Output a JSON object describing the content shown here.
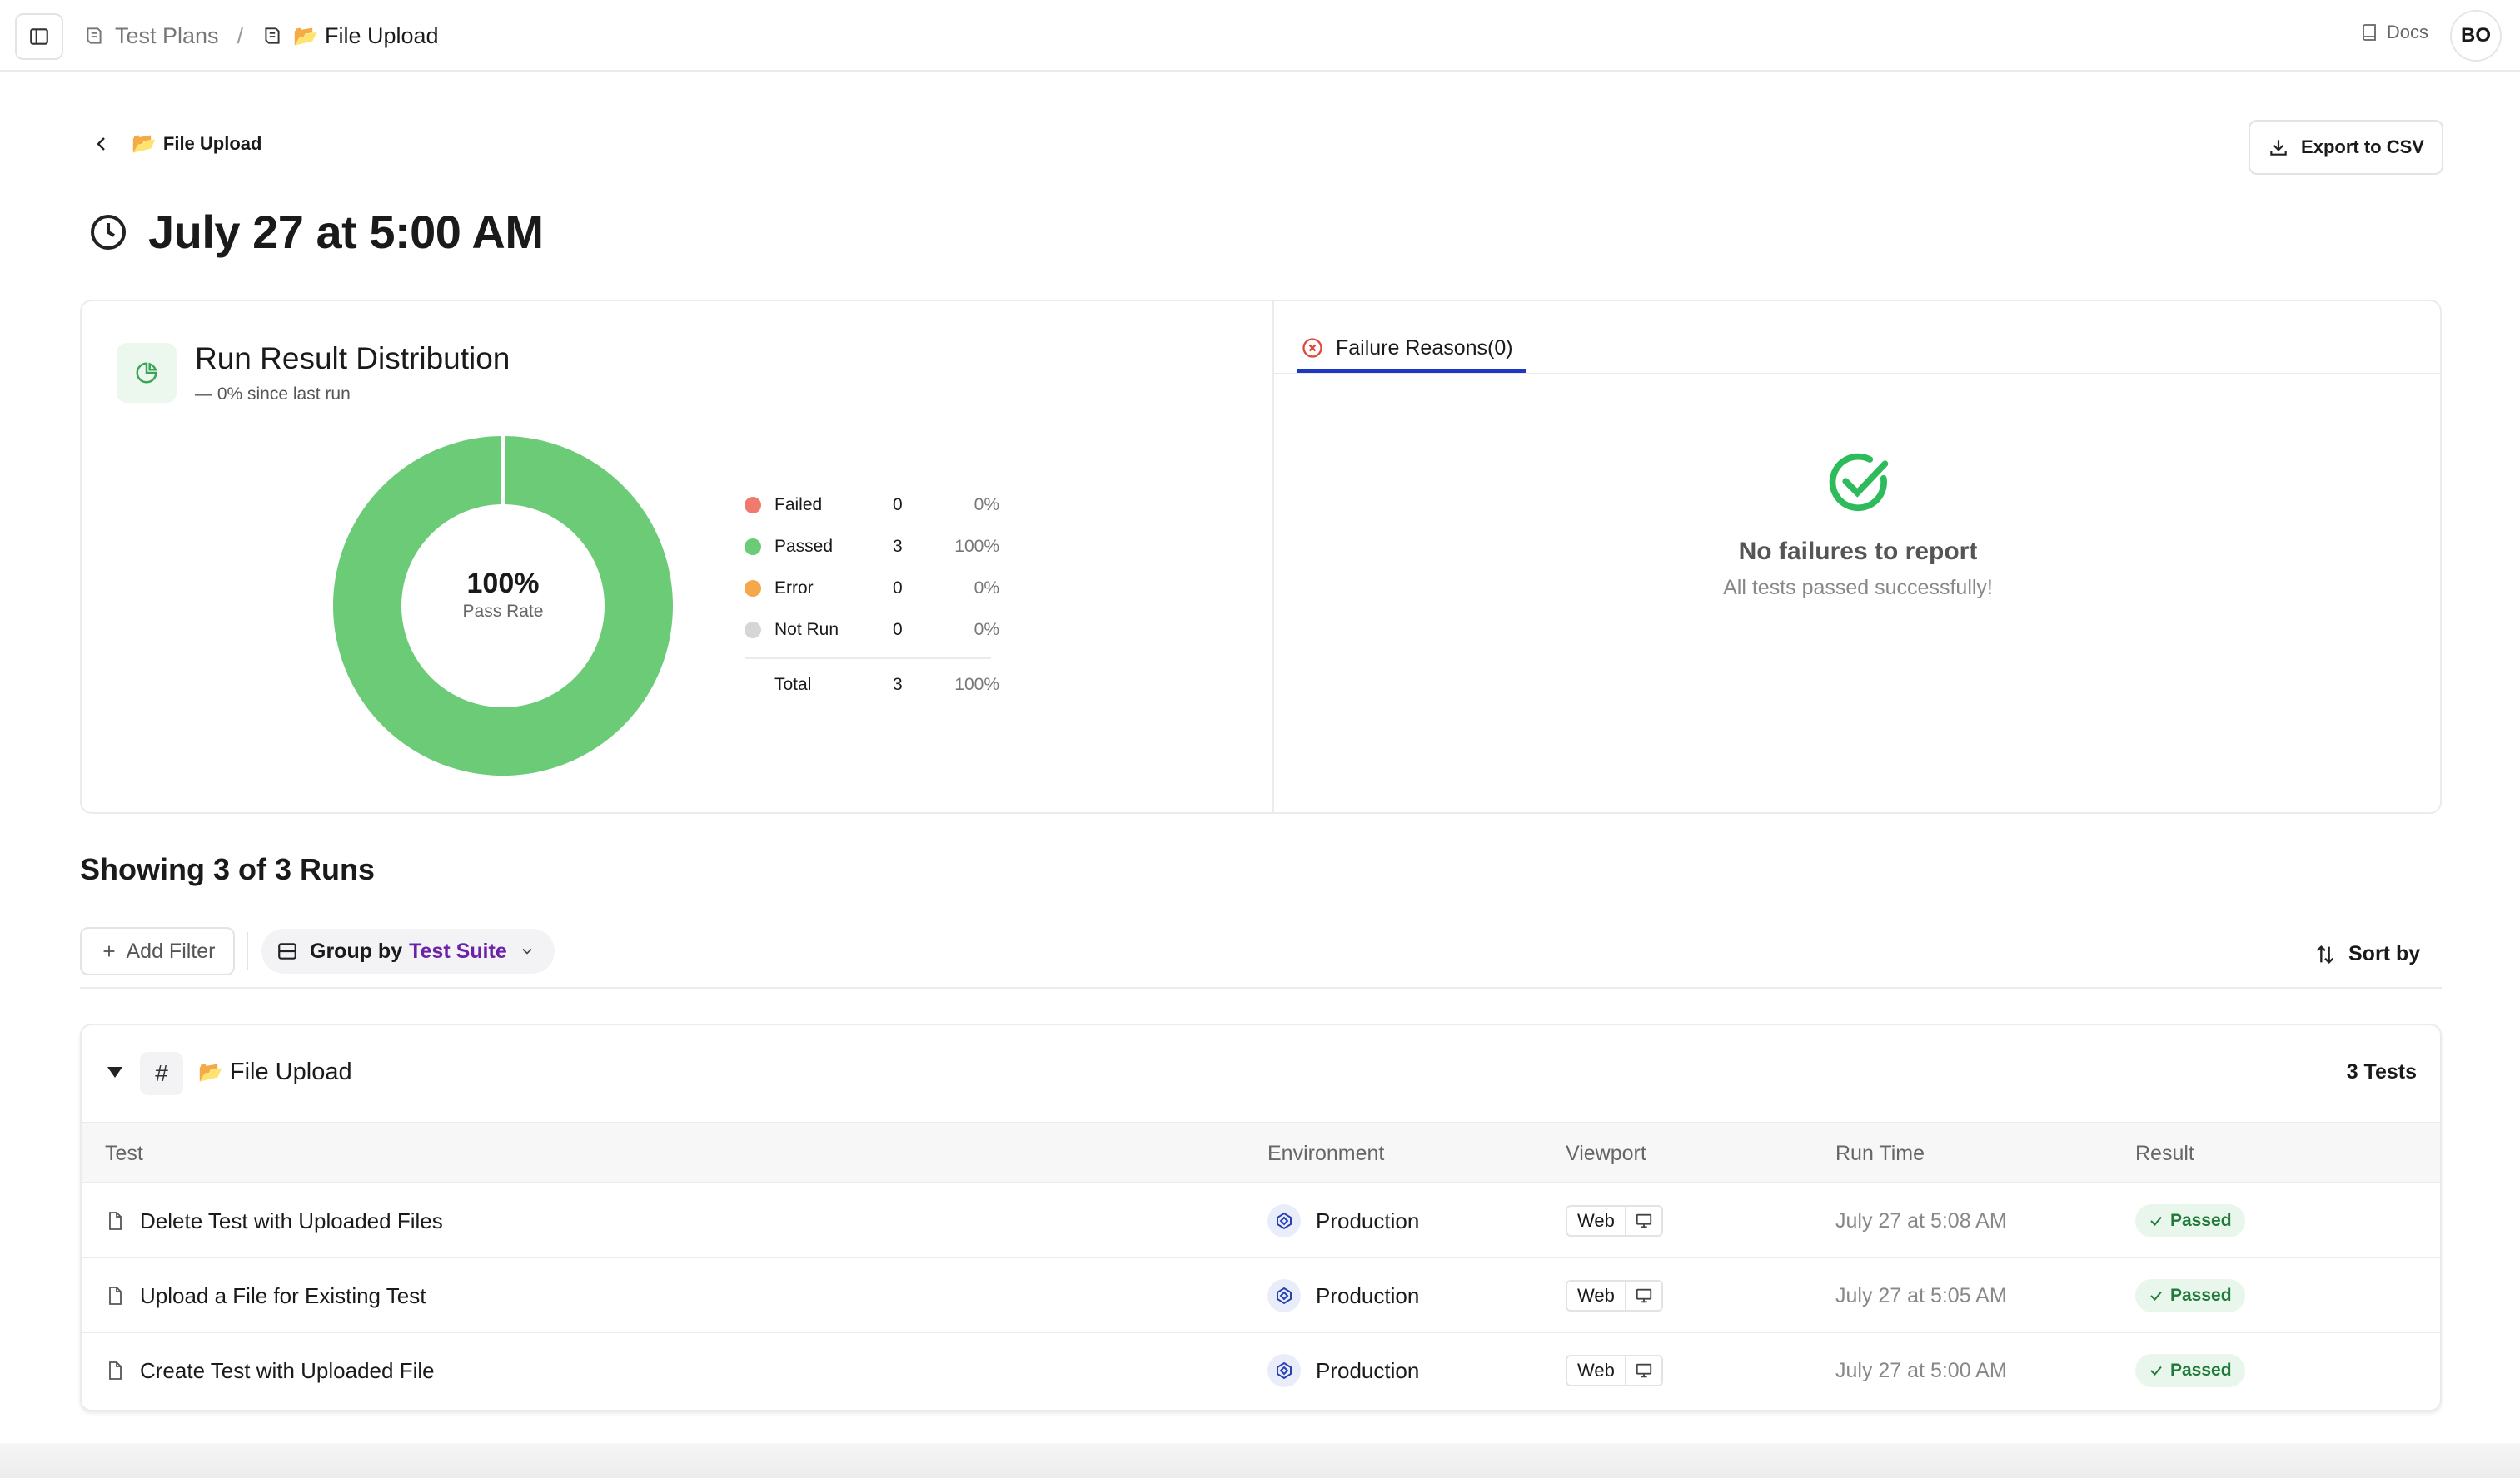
{
  "topbar": {
    "breadcrumb_root": "Test Plans",
    "breadcrumb_sep": "/",
    "breadcrumb_current_emoji": "📂",
    "breadcrumb_current": "File Upload",
    "docs_label": "Docs",
    "avatar_initials": "BO"
  },
  "header": {
    "back_emoji": "📂",
    "back_label": "File Upload",
    "export_label": "Export to CSV",
    "run_title": "July 27 at 5:00 AM"
  },
  "distribution": {
    "title": "Run Result Distribution",
    "subtitle": "— 0% since last run",
    "center_pct": "100%",
    "center_label": "Pass Rate",
    "legend": [
      {
        "name": "Failed",
        "count": "0",
        "pct": "0%",
        "color": "#ef7a6d"
      },
      {
        "name": "Passed",
        "count": "3",
        "pct": "100%",
        "color": "#6bcb77"
      },
      {
        "name": "Error",
        "count": "0",
        "pct": "0%",
        "color": "#f5a74b"
      },
      {
        "name": "Not Run",
        "count": "0",
        "pct": "0%",
        "color": "#d6d6d6"
      }
    ],
    "total": {
      "name": "Total",
      "count": "3",
      "pct": "100%"
    }
  },
  "chart_data": {
    "type": "pie",
    "categories": [
      "Failed",
      "Passed",
      "Error",
      "Not Run"
    ],
    "values": [
      0,
      3,
      0,
      0
    ],
    "title": "Run Result Distribution"
  },
  "failures": {
    "tab_label": "Failure Reasons(0)",
    "empty_title": "No failures to report",
    "empty_subtitle": "All tests passed successfully!"
  },
  "runs": {
    "title": "Showing 3 of 3 Runs",
    "add_filter": "Add Filter",
    "group_by_label": "Group by",
    "group_by_value": "Test Suite",
    "sort_label": "Sort by"
  },
  "group": {
    "emoji": "📂",
    "name": "File Upload",
    "count": "3 Tests",
    "columns": [
      "Test",
      "Environment",
      "Viewport",
      "Run Time",
      "Result"
    ],
    "rows": [
      {
        "test": "Delete Test with Uploaded Files",
        "env": "Production",
        "viewport": "Web",
        "time": "July 27 at 5:08 AM",
        "result": "Passed"
      },
      {
        "test": "Upload a File for Existing Test",
        "env": "Production",
        "viewport": "Web",
        "time": "July 27 at 5:05 AM",
        "result": "Passed"
      },
      {
        "test": "Create Test with Uploaded File",
        "env": "Production",
        "viewport": "Web",
        "time": "July 27 at 5:00 AM",
        "result": "Passed"
      }
    ]
  },
  "colors": {
    "accent_blue": "#1d39c4",
    "accent_purple": "#6b21a8",
    "passed_green": "#6bcb77"
  }
}
